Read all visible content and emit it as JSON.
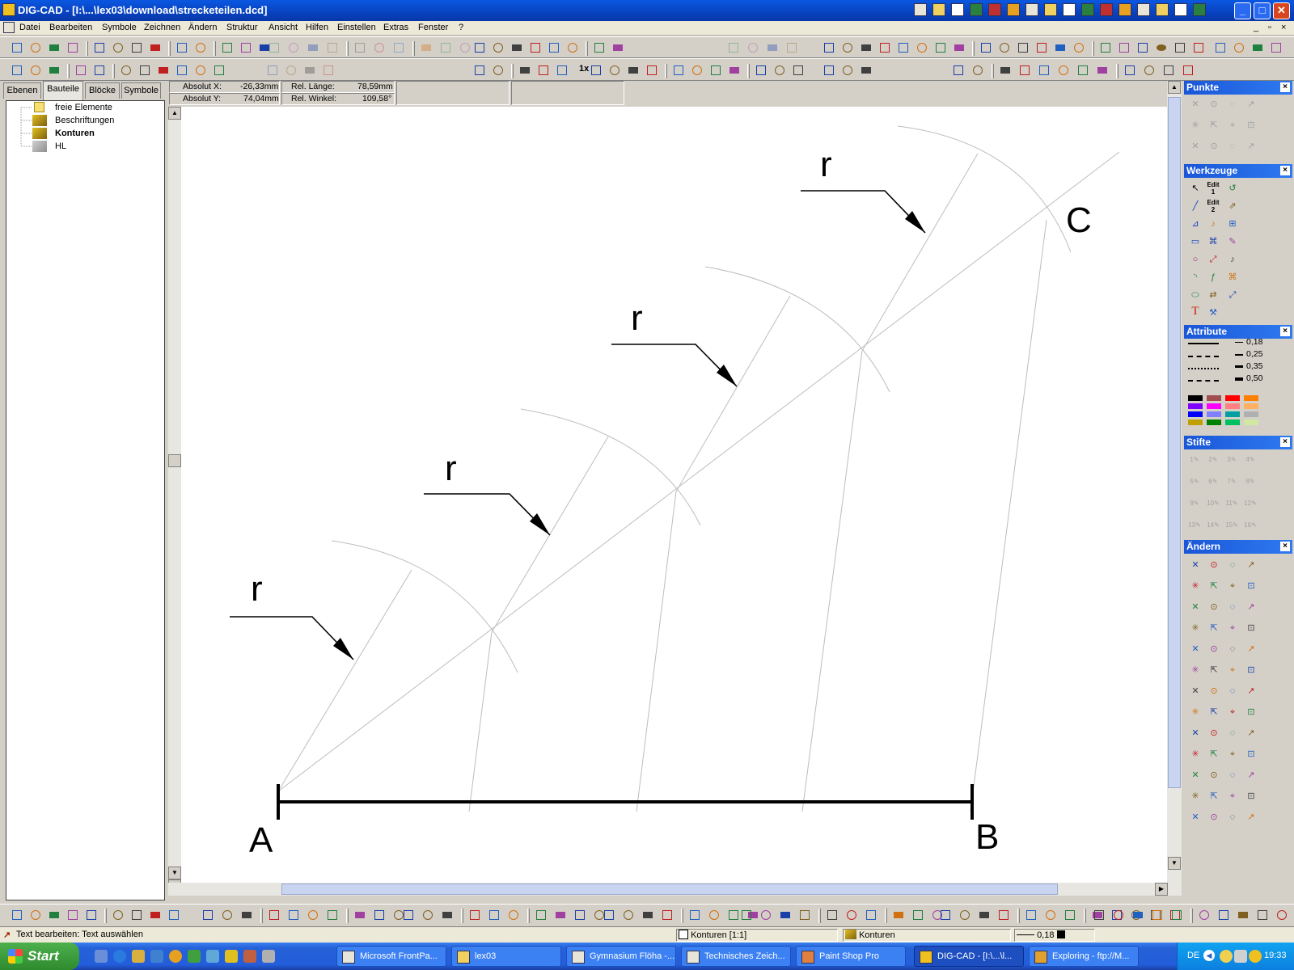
{
  "window": {
    "title": "DIG-CAD - [I:\\...\\lex03\\download\\strecketeilen.dcd]",
    "min": "_",
    "max": "□",
    "close": "✕"
  },
  "menu": [
    "Datei",
    "Bearbeiten",
    "Symbole",
    "Zeichnen",
    "Ändern",
    "Struktur",
    "Ansicht",
    "Hilfen",
    "Einstellen",
    "Extras",
    "Fenster",
    "?"
  ],
  "left_panel": {
    "tabs": [
      "Ebenen",
      "Bauteile",
      "Blöcke",
      "Symbole"
    ],
    "active_tab": 1,
    "tree": [
      "freie Elemente",
      "Beschriftungen",
      "Konturen",
      "HL"
    ]
  },
  "coords": {
    "abs_x_label": "Absolut X:",
    "abs_x": "-26,33mm",
    "abs_y_label": "Absolut Y:",
    "abs_y": "74,04mm",
    "rel_len_label": "Rel. Länge:",
    "rel_len": "78,59mm",
    "rel_ang_label": "Rel. Winkel:",
    "rel_ang": "109,58°"
  },
  "toolbar": {
    "zoom_label": "1x"
  },
  "drawing": {
    "label_a": "A",
    "label_b": "B",
    "label_c": "C",
    "radius_label": "r"
  },
  "panels": {
    "punkte": "Punkte",
    "werkzeuge": "Werkzeuge",
    "attribute": "Attribute",
    "stifte": "Stifte",
    "aendern": "Ändern",
    "line_widths": [
      "0,18",
      "0,25",
      "0,35",
      "0,50"
    ],
    "pen_numbers": [
      "1",
      "2",
      "3",
      "4",
      "5",
      "6",
      "7",
      "8",
      "9",
      "10",
      "11",
      "12",
      "13",
      "14",
      "15",
      "16"
    ],
    "edit1": "Edit 1",
    "edit2": "Edit 2"
  },
  "colors": {
    "accent": "#0a58e0",
    "palette": [
      "#000000",
      "#a05050",
      "#ff0000",
      "#ff8000",
      "#8000ff",
      "#ff00ff",
      "#ff8080",
      "#ffb060",
      "#0000ff",
      "#8080ff",
      "#00a0a0",
      "#b0b0b0",
      "#c0a000",
      "#008000",
      "#00c060",
      "#d0e8a0"
    ]
  },
  "status": {
    "text": "Text bearbeiten: Text auswählen",
    "layer": "Konturen [1:1]",
    "part": "Konturen",
    "width": "0,18"
  },
  "taskbar": {
    "start": "Start",
    "tasks": [
      "Microsoft FrontPa...",
      "lex03",
      "Gymnasium Flöha -...",
      "Technisches Zeich...",
      "Paint Shop Pro",
      "DIG-CAD - [I:\\...\\l...",
      "Exploring - ftp://M..."
    ],
    "active_task": 5,
    "lang": "DE",
    "clock": "19:33"
  }
}
